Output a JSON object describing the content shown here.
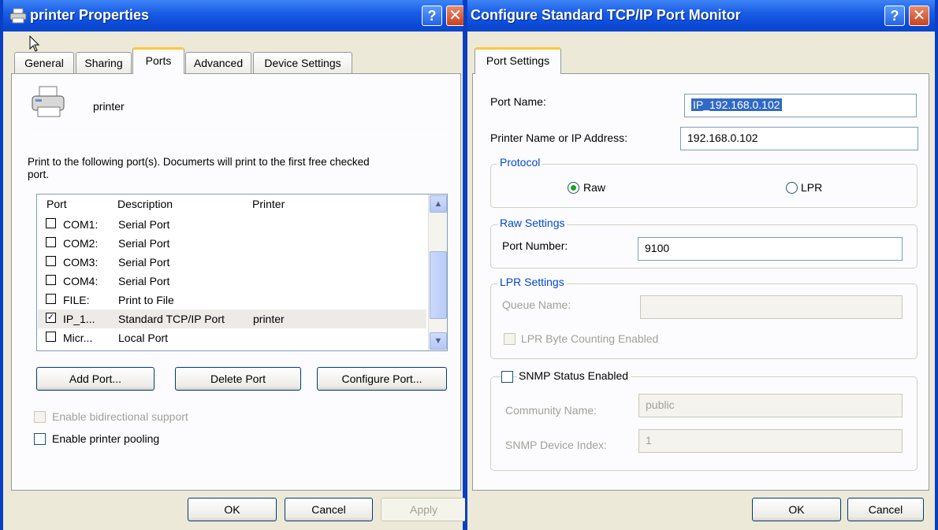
{
  "left_window": {
    "title": "printer Properties",
    "tabs": [
      "General",
      "Sharing",
      "Ports",
      "Advanced",
      "Device Settings"
    ],
    "printer_name": "printer",
    "description": "Print to the following port(s). Documerts will print to the first free checked port.",
    "columns": [
      "Port",
      "Description",
      "Printer"
    ],
    "ports": [
      {
        "port": "COM1:",
        "description": "Serial Port",
        "printer": "",
        "checked": false
      },
      {
        "port": "COM2:",
        "description": "Serial Port",
        "printer": "",
        "checked": false
      },
      {
        "port": "COM3:",
        "description": "Serial Port",
        "printer": "",
        "checked": false
      },
      {
        "port": "COM4:",
        "description": "Serial Port",
        "printer": "",
        "checked": false
      },
      {
        "port": "FILE:",
        "description": "Print to File",
        "printer": "",
        "checked": false
      },
      {
        "port": "IP_1...",
        "description": "Standard TCP/IP Port",
        "printer": "printer",
        "checked": true
      },
      {
        "port": "Micr...",
        "description": "Local Port",
        "printer": "",
        "checked": false
      }
    ],
    "add_port": "Add Port...",
    "delete_port": "Delete Port",
    "configure_port": "Configure Port...",
    "bidirectional": "Enable bidirectional support",
    "pooling": "Enable printer pooling",
    "ok": "OK",
    "cancel": "Cancel",
    "apply": "Apply"
  },
  "right_window": {
    "title": "Configure Standard TCP/IP Port Monitor",
    "tab": "Port Settings",
    "port_name_label": "Port Name:",
    "port_name_value": "IP_192.168.0.102",
    "ip_label": "Printer Name or IP Address:",
    "ip_value": "192.168.0.102",
    "protocol_title": "Protocol",
    "raw": "Raw",
    "lpr": "LPR",
    "raw_settings_title": "Raw Settings",
    "port_number_label": "Port Number:",
    "port_number_value": "9100",
    "lpr_settings_title": "LPR Settings",
    "queue_name_label": "Queue Name:",
    "queue_name_value": "",
    "lpr_byte_counting": "LPR Byte Counting Enabled",
    "snmp_enabled": "SNMP Status Enabled",
    "community_label": "Community Name:",
    "community_value": "public",
    "snmp_index_label": "SNMP Device Index:",
    "snmp_index_value": "1",
    "ok": "OK",
    "cancel": "Cancel"
  },
  "icons": {
    "help": "?",
    "close": "✕"
  }
}
